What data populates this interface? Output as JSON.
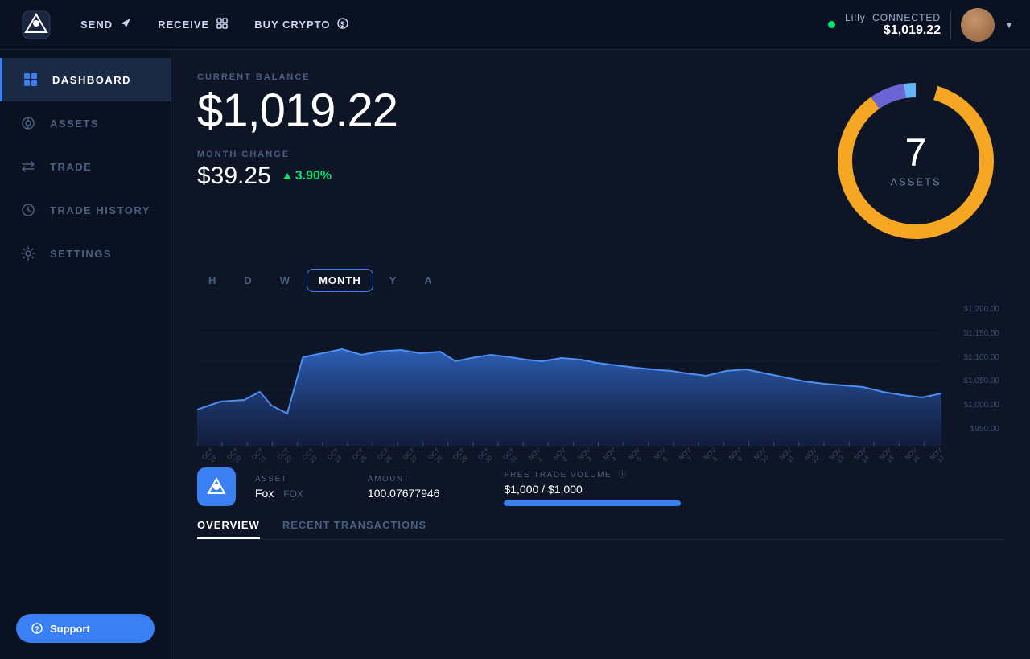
{
  "topnav": {
    "actions": [
      {
        "id": "send",
        "label": "SEND",
        "icon": "send-icon"
      },
      {
        "id": "receive",
        "label": "RECEIVE",
        "icon": "receive-icon"
      },
      {
        "id": "buy-crypto",
        "label": "BUY CRYPTO",
        "icon": "buy-icon"
      }
    ],
    "user": {
      "name": "Lilly",
      "status": "CONNECTED",
      "balance": "$1,019.22"
    }
  },
  "sidebar": {
    "items": [
      {
        "id": "dashboard",
        "label": "DASHBOARD",
        "icon": "dashboard-icon",
        "active": true
      },
      {
        "id": "assets",
        "label": "ASSETS",
        "icon": "assets-icon",
        "active": false
      },
      {
        "id": "trade",
        "label": "TRADE",
        "icon": "trade-icon",
        "active": false
      },
      {
        "id": "trade-history",
        "label": "TRADE HISTORY",
        "icon": "history-icon",
        "active": false
      },
      {
        "id": "settings",
        "label": "SETTINGS",
        "icon": "settings-icon",
        "active": false
      }
    ],
    "support_label": "Support"
  },
  "dashboard": {
    "current_balance_label": "CURRENT BALANCE",
    "current_balance": "$1,019.22",
    "month_change_label": "MONTH CHANGE",
    "month_change_amount": "$39.25",
    "month_change_pct": "3.90%",
    "donut": {
      "number": "7",
      "label": "ASSETS"
    },
    "time_filters": [
      {
        "id": "H",
        "label": "H"
      },
      {
        "id": "D",
        "label": "D"
      },
      {
        "id": "W",
        "label": "W"
      },
      {
        "id": "MONTH",
        "label": "MONTH",
        "active": true
      },
      {
        "id": "Y",
        "label": "Y"
      },
      {
        "id": "A",
        "label": "A"
      }
    ],
    "chart": {
      "y_labels": [
        "$1,200.00",
        "$1,150.00",
        "$1,100.00",
        "$1,050.00",
        "$1,000.00",
        "$950.00"
      ],
      "x_labels": [
        "OCT 19",
        "OCT 20",
        "OCT 21",
        "OCT 22",
        "OCT 23",
        "OCT 24",
        "OCT 25",
        "OCT 26",
        "OCT 27",
        "OCT 28",
        "OCT 29",
        "OCT 30",
        "OCT 31",
        "NOV 1",
        "NOV 2",
        "NOV 3",
        "NOV 4",
        "NOV 5",
        "NOV 6",
        "NOV 7",
        "NOV 8",
        "NOV 9",
        "NOV 10",
        "NOV 11",
        "NOV 12",
        "NOV 13",
        "NOV 14",
        "NOV 15",
        "NOV 16",
        "NOV 17"
      ]
    },
    "asset": {
      "icon": "fox-icon",
      "name": "Fox",
      "ticker": "FOX",
      "col_asset": "ASSET",
      "col_amount": "AMOUNT",
      "col_trade_volume": "FREE TRADE VOLUME",
      "amount": "100.07677946",
      "trade_volume": "$1,000 / $1,000",
      "trade_volume_pct": 100
    },
    "tabs": [
      {
        "id": "overview",
        "label": "OVERVIEW",
        "active": true
      },
      {
        "id": "recent-transactions",
        "label": "RECENT TRANSACTIONS",
        "active": false
      }
    ]
  },
  "colors": {
    "accent_blue": "#3b7ff5",
    "accent_orange": "#f5a623",
    "accent_purple": "#6c63d4",
    "accent_green": "#00e676",
    "bg_dark": "#0a1120",
    "bg_main": "#0d1526"
  }
}
